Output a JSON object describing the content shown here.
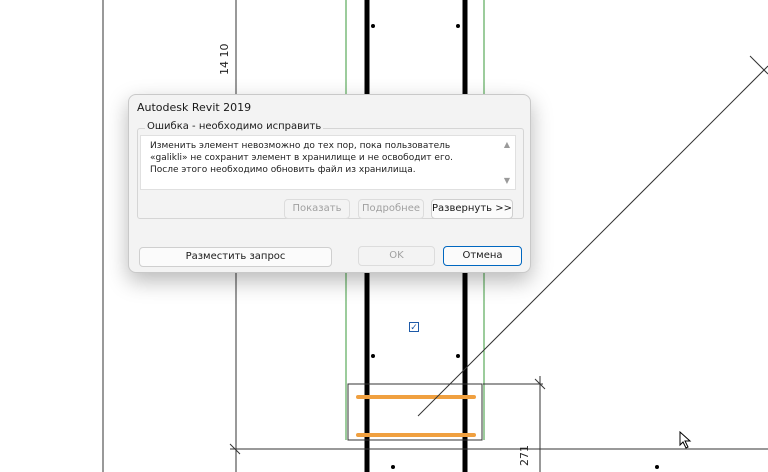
{
  "drawing": {
    "dimension_top": "14 10",
    "dimension_bottom": "271"
  },
  "dialog": {
    "title": "Autodesk Revit 2019",
    "group_label": "Ошибка - необходимо исправить",
    "message": "Изменить элемент невозможно до тех пор, пока пользователь «galikli» не сохранит элемент в хранилище и не освободит его. После этого необходимо обновить файл из хранилища.",
    "buttons": {
      "show": "Показать",
      "more_info": "Подробнее",
      "expand": "Развернуть >>",
      "place_request": "Разместить запрос",
      "ok": "OK",
      "cancel": "Отмена"
    }
  }
}
